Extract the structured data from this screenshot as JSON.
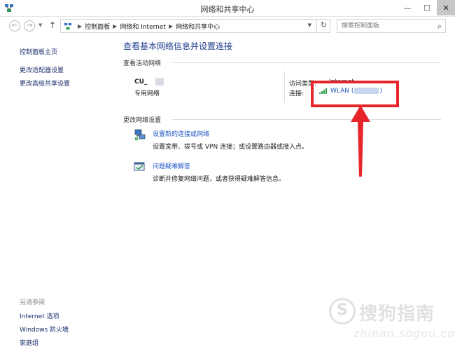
{
  "window": {
    "title": "网络和共享中心",
    "controls": {
      "minimize": "—",
      "maximize": "☐",
      "close": "✕"
    }
  },
  "nav": {
    "back_glyph": "←",
    "forward_glyph": "→",
    "up_glyph": "↑",
    "breadcrumbs": [
      "控制面板",
      "网络和 Internet",
      "网络和共享中心"
    ],
    "refresh_glyph": "↻",
    "search_placeholder": "搜索控制面板"
  },
  "sidebar": {
    "items": [
      {
        "label": "控制面板主页"
      },
      {
        "label": "更改适配器设置"
      },
      {
        "label": "更改高级共享设置"
      }
    ],
    "see_also_heading": "另请参阅",
    "see_also": [
      {
        "label": "Internet 选项"
      },
      {
        "label": "Windows 防火墙"
      },
      {
        "label": "家庭组"
      }
    ]
  },
  "main": {
    "title": "查看基本网络信息并设置连接",
    "active_networks_heading": "查看活动网络",
    "network": {
      "name": "CU_",
      "type": "专用网络",
      "access_type_label": "访问类型:",
      "access_type_value": "Internet",
      "connections_label": "连接:",
      "connection_name": "WLAN (",
      "connection_suffix": ")"
    },
    "change_settings_heading": "更改网络设置",
    "tasks": [
      {
        "link": "设置新的连接或网络",
        "description": "设置宽带、拨号或 VPN 连接；或设置路由器或接入点。",
        "icon": "network-setup-icon"
      },
      {
        "link": "问题疑难解答",
        "description": "诊断并修复网络问题，或者获得疑难解答信息。",
        "icon": "troubleshoot-icon"
      }
    ]
  },
  "annotation": {
    "color": "#e6262b"
  },
  "watermark": {
    "brand": "搜狗指南",
    "url": "zhinan.sogou.com"
  }
}
